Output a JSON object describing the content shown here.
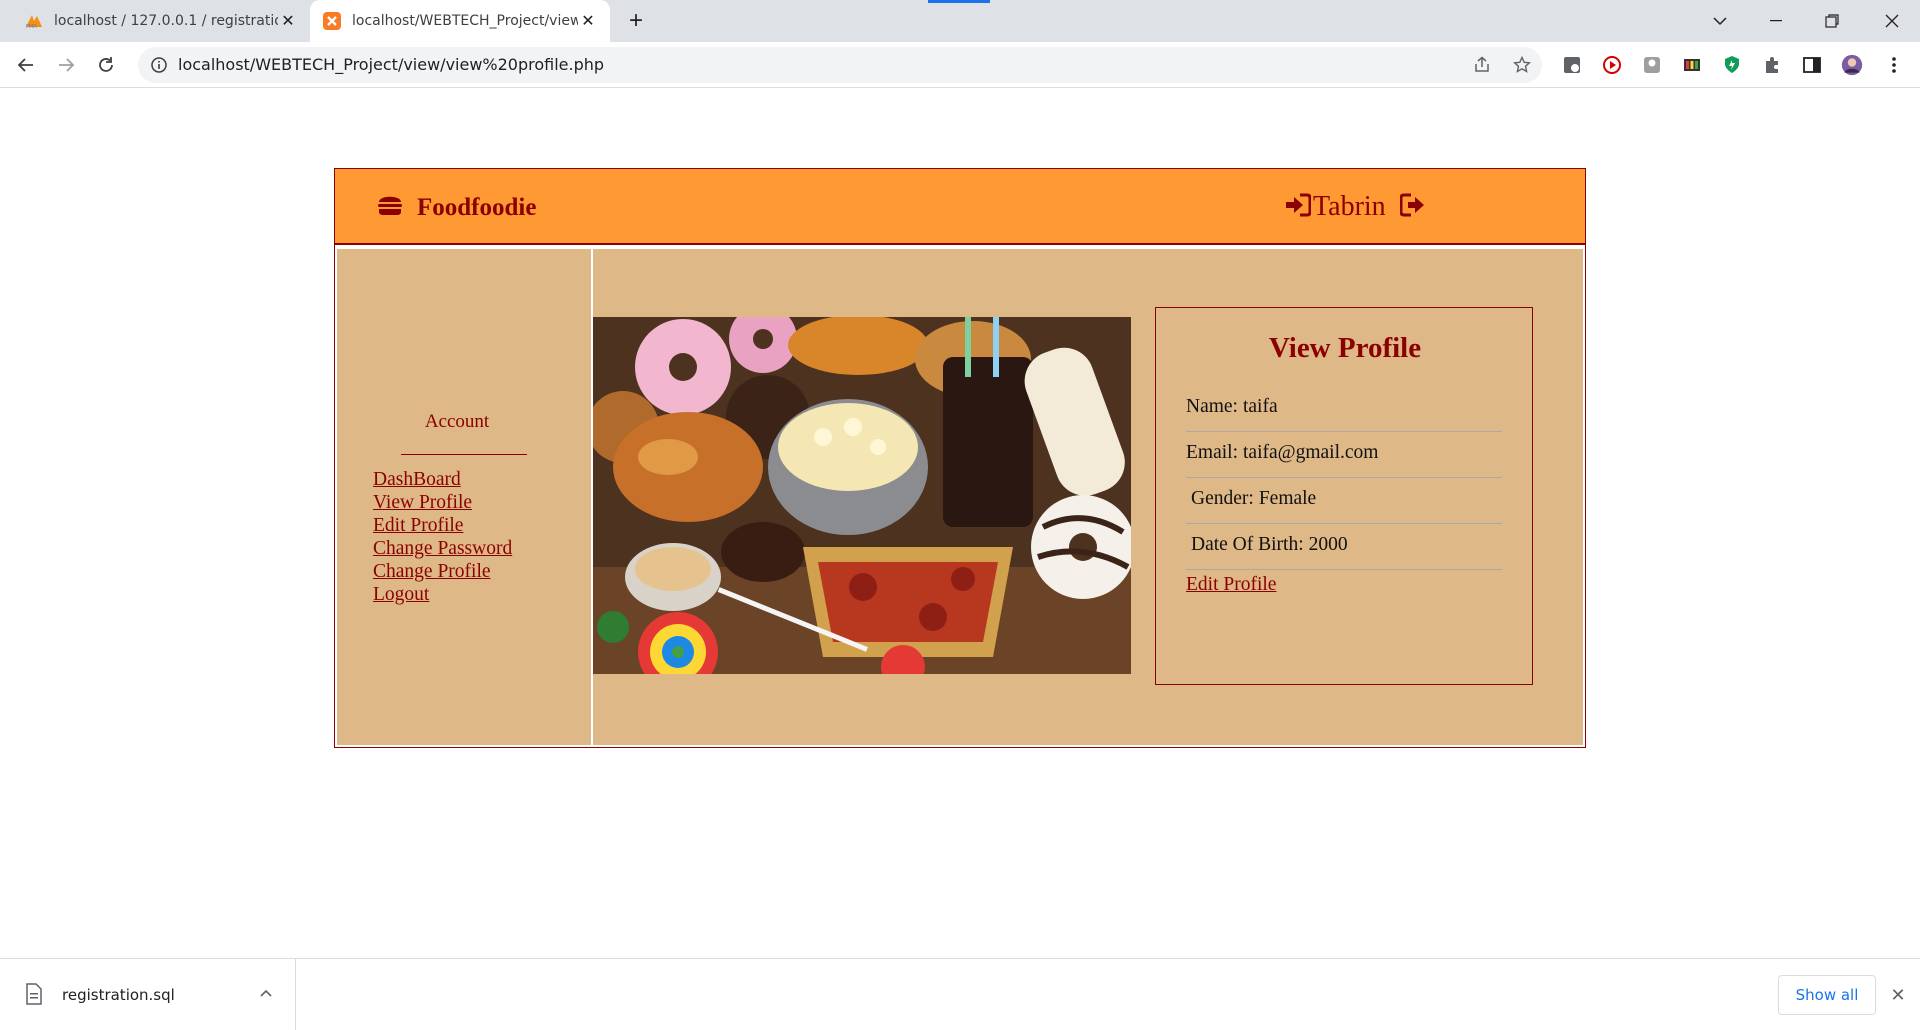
{
  "browser": {
    "tabs": [
      {
        "title": "localhost / 127.0.0.1 / registration",
        "icon": "phpmyadmin-icon",
        "active": false
      },
      {
        "title": "localhost/WEBTECH_Project/view",
        "icon": "xampp-icon",
        "active": true
      }
    ],
    "url": "localhost/WEBTECH_Project/view/view%20profile.php"
  },
  "site": {
    "brand": "Foodfoodie",
    "user_name": "Tabrin",
    "accent": "#8b0000",
    "header_bg": "#ff9933",
    "body_bg": "#deb887"
  },
  "sidebar": {
    "title": "Account",
    "links": [
      "DashBoard",
      "View Profile",
      "Edit Profile",
      "Change Password",
      "Change Profile",
      "Logout"
    ]
  },
  "profile": {
    "heading": "View Profile",
    "rows": [
      {
        "label": "Name:",
        "value": "taifa"
      },
      {
        "label": "Email:",
        "value": "taifa@gmail.com"
      },
      {
        "label": "Gender:",
        "value": "Female"
      },
      {
        "label": "Date Of Birth:",
        "value": "2000"
      }
    ],
    "edit_link": "Edit Profile"
  },
  "downloads": {
    "file": "registration.sql",
    "show_all": "Show all"
  }
}
